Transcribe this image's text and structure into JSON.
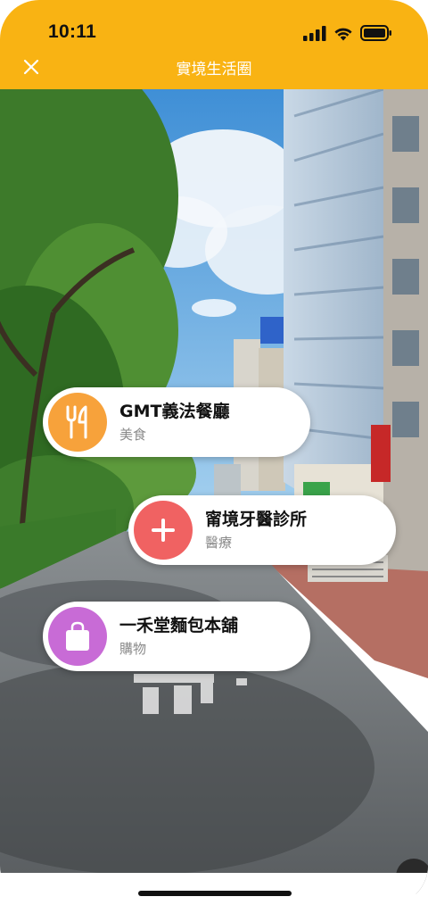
{
  "status_bar": {
    "time": "10:11",
    "icons": [
      "signal-icon",
      "wifi-icon",
      "battery-icon"
    ]
  },
  "header": {
    "title": "實境生活圈",
    "close_icon": "close-icon",
    "background": "#F9B313"
  },
  "places": [
    {
      "name": "GMT義法餐廳",
      "category": "美食",
      "icon": "utensils-icon",
      "color": "#F7A23B"
    },
    {
      "name": "甯境牙醫診所",
      "category": "醫療",
      "icon": "plus-icon",
      "color": "#F06262"
    },
    {
      "name": "一禾堂麵包本舖",
      "category": "購物",
      "icon": "shopping-bag-icon",
      "color": "#C86BD6"
    }
  ]
}
